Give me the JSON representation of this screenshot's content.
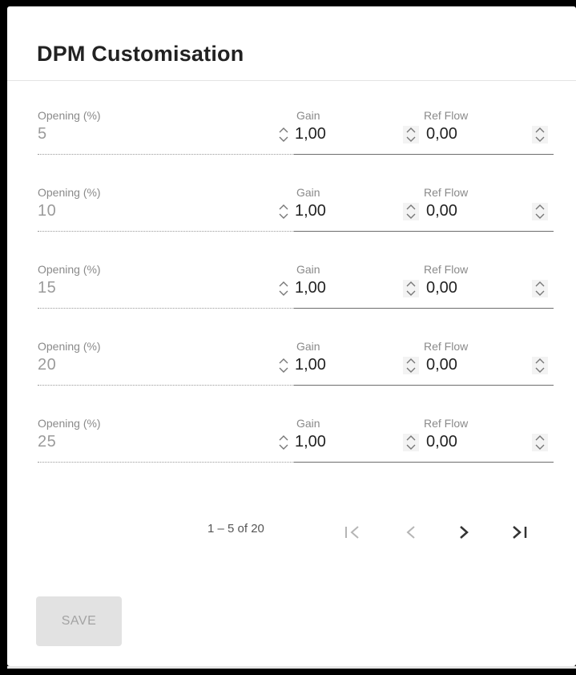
{
  "card": {
    "title": "DPM Customisation"
  },
  "labels": {
    "opening": "Opening (%)",
    "gain": "Gain",
    "ref_flow": "Ref Flow"
  },
  "rows": [
    {
      "opening": "5",
      "gain": "1,00",
      "ref_flow": "0,00"
    },
    {
      "opening": "10",
      "gain": "1,00",
      "ref_flow": "0,00"
    },
    {
      "opening": "15",
      "gain": "1,00",
      "ref_flow": "0,00"
    },
    {
      "opening": "20",
      "gain": "1,00",
      "ref_flow": "0,00"
    },
    {
      "opening": "25",
      "gain": "1,00",
      "ref_flow": "0,00"
    }
  ],
  "paginator": {
    "range_label": "1 – 5 of 20",
    "icons": {
      "first": "first-page-icon",
      "prev": "chevron-left-icon",
      "next": "chevron-right-icon",
      "last": "last-page-icon"
    }
  },
  "actions": {
    "save_label": "SAVE"
  },
  "icons": {
    "spinner": "spinner-up-down-icon"
  },
  "colors": {
    "label": "#8a8a8a",
    "value": "#222222",
    "disabled_value": "#9b9b9b",
    "button_bg": "#e2e2e2",
    "button_text": "#a3a3a3"
  }
}
